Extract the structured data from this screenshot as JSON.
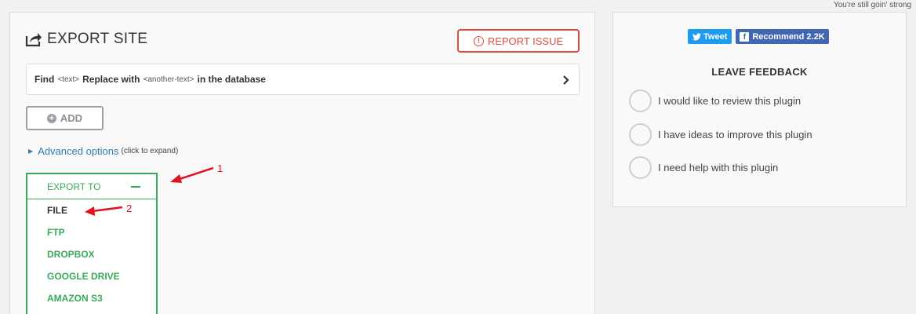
{
  "top_note": "You're still goin' strong",
  "export": {
    "title": "EXPORT SITE",
    "report_label": "REPORT ISSUE",
    "find_row": {
      "find_label": "Find",
      "text_tag": "<text>",
      "replace_label": "Replace with",
      "another_tag": "<another-text>",
      "suffix": "in the database"
    },
    "add_label": "ADD",
    "advanced": {
      "link": "Advanced options",
      "hint": "(click to expand)"
    },
    "export_to": {
      "label": "EXPORT TO",
      "items": [
        "FILE",
        "FTP",
        "DROPBOX",
        "GOOGLE DRIVE",
        "AMAZON S3"
      ]
    },
    "annotations": [
      "1",
      "2"
    ]
  },
  "feedback": {
    "tweet_label": "Tweet",
    "recommend_label": "Recommend 2.2K",
    "title": "LEAVE FEEDBACK",
    "options": [
      "I would like to review this plugin",
      "I have ideas to improve this plugin",
      "I need help with this plugin"
    ]
  },
  "colors": {
    "accent_green": "#3aaa5a",
    "danger_red": "#e34a3f",
    "link_blue": "#2d7fb5",
    "twitter_blue": "#1d9bf0",
    "facebook_blue": "#4267b2",
    "annotation_red": "#e0141e"
  }
}
